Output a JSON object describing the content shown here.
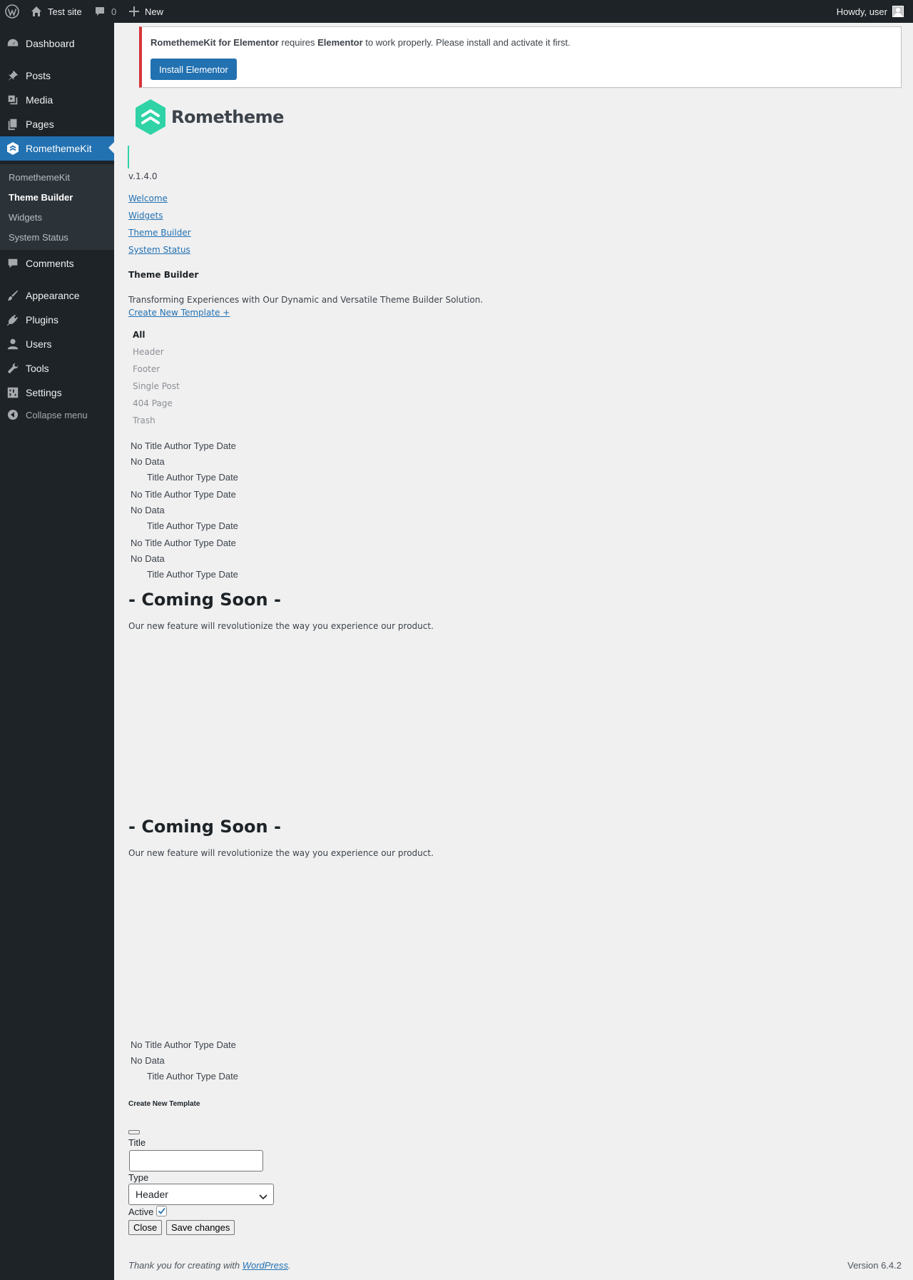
{
  "adminbar": {
    "site_name": "Test site",
    "comments_count": "0",
    "new_label": "New",
    "howdy": "Howdy, user"
  },
  "sidebar": {
    "items": [
      {
        "label": "Dashboard",
        "icon": "dashboard-icon"
      },
      {
        "label": "Posts",
        "icon": "pin-icon"
      },
      {
        "label": "Media",
        "icon": "media-icon"
      },
      {
        "label": "Pages",
        "icon": "pages-icon"
      },
      {
        "label": "RomethemeKit",
        "icon": "romethemekit-icon"
      },
      {
        "label": "Comments",
        "icon": "comment-icon"
      },
      {
        "label": "Appearance",
        "icon": "brush-icon"
      },
      {
        "label": "Plugins",
        "icon": "plug-icon"
      },
      {
        "label": "Users",
        "icon": "user-icon"
      },
      {
        "label": "Tools",
        "icon": "wrench-icon"
      },
      {
        "label": "Settings",
        "icon": "settings-icon"
      }
    ],
    "submenu": [
      "RomethemeKit",
      "Theme Builder",
      "Widgets",
      "System Status"
    ],
    "collapse": "Collapse menu"
  },
  "notice": {
    "plugin": "RomethemeKit for Elementor",
    "requires": "requires",
    "dependency": "Elementor",
    "rest": "to work properly. Please install and activate it first.",
    "button": "Install Elementor"
  },
  "brand": {
    "name": "Rometheme",
    "version": "v.1.4.0",
    "accent": "#2fd3a6"
  },
  "nav_links": [
    "Welcome",
    "Widgets",
    "Theme Builder",
    "System Status"
  ],
  "page": {
    "title": "Theme Builder",
    "description": "Transforming Experiences with Our Dynamic and Versatile Theme Builder Solution.",
    "create_link": "Create New Template +"
  },
  "tabs": [
    "All",
    "Header",
    "Footer",
    "Single Post",
    "404 Page",
    "Trash"
  ],
  "table": {
    "header": "No Title Author Type Date",
    "empty": "No Data",
    "footer": "Title Author Type Date"
  },
  "coming_soon": {
    "title": "- Coming Soon -",
    "text": "Our new feature will revolutionize the way you experience our product."
  },
  "modal": {
    "heading": "Create New Template",
    "title_label": "Title",
    "title_value": "",
    "type_label": "Type",
    "type_value": "Header",
    "active_label": "Active",
    "active_checked": true,
    "close_btn": "Close",
    "save_btn": "Save changes"
  },
  "footer": {
    "thanks": "Thank you for creating with",
    "wp_link": "WordPress",
    "version": "Version 6.4.2"
  }
}
